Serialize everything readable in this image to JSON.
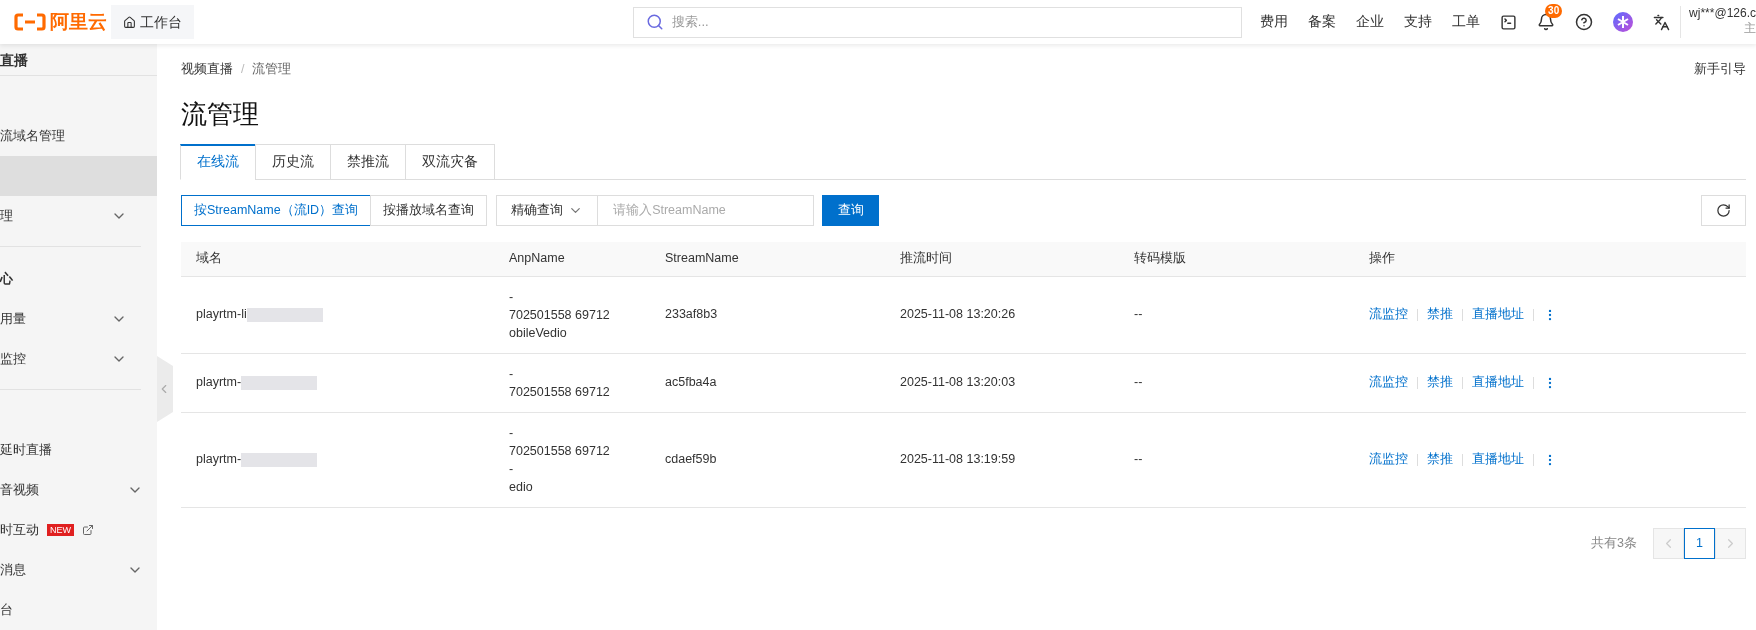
{
  "topbar": {
    "logo": "阿里云",
    "workbench": "工作台",
    "search": {
      "placeholder": "搜索..."
    },
    "links": [
      "费用",
      "备案",
      "企业",
      "支持",
      "工单"
    ],
    "notifications": "30",
    "user": "wj***@126.c",
    "role": "主"
  },
  "sidebar": {
    "title": "直播",
    "groups": [
      {
        "items": [
          {
            "label": "流域名管理",
            "selected": false,
            "expandable": false
          },
          {
            "selected": true,
            "expandable": false
          },
          {
            "label": "理",
            "selected": false,
            "expandable": true
          }
        ]
      },
      {
        "heading": "心",
        "items": [
          {
            "label": "用量",
            "selected": false,
            "expandable": true
          },
          {
            "label": "监控",
            "selected": false,
            "expandable": true
          }
        ]
      },
      {
        "items": [
          {
            "label": "延时直播",
            "selected": false,
            "expandable": false
          },
          {
            "label": "音视频",
            "selected": false,
            "expandable": true
          },
          {
            "label": "时互动",
            "badge": "NEW",
            "external": true,
            "selected": false,
            "expandable": false
          },
          {
            "label": "消息",
            "selected": false,
            "expandable": true
          },
          {
            "label": "台",
            "selected": false,
            "expandable": false
          }
        ]
      }
    ]
  },
  "breadcrumb": [
    "视频直播",
    "流管理"
  ],
  "breadcrumb_separator": "/",
  "guide": "新手引导",
  "title": "流管理",
  "tabs": [
    {
      "label": "在线流",
      "selected": true
    },
    {
      "label": "历史流",
      "selected": false
    },
    {
      "label": "禁推流",
      "selected": false
    },
    {
      "label": "双流灾备",
      "selected": false
    }
  ],
  "query": {
    "modes": [
      {
        "label": "按StreamName（流ID）查询",
        "selected": true
      },
      {
        "label": "按播放域名查询",
        "selected": false
      }
    ],
    "match": "精确查询",
    "input": {
      "placeholder": "请输入StreamName"
    },
    "submit": "查询"
  },
  "table": {
    "columns": [
      "域名",
      "AnpName",
      "StreamName",
      "推流时间",
      "转码模版",
      "操作"
    ],
    "rows": [
      {
        "domain": "playrtm-li",
        "app": [
          "-",
          "702501558 69712",
          "obileVedio"
        ],
        "stream": "233af8b3",
        "time": "2025-11-08 13:20:26",
        "template": "--",
        "actions": [
          "流监控",
          "禁推",
          "直播地址"
        ]
      },
      {
        "domain": "playrtm-",
        "app": [
          "-",
          "702501558 69712"
        ],
        "stream": "ac5fba4a",
        "time": "2025-11-08 13:20:03",
        "template": "--",
        "actions": [
          "流监控",
          "禁推",
          "直播地址"
        ]
      },
      {
        "domain": "playrtm-",
        "app": [
          "-",
          "702501558 69712",
          "-",
          "edio"
        ],
        "stream": "cdaef59b",
        "time": "2025-11-08 13:19:59",
        "template": "--",
        "actions": [
          "流监控",
          "禁推",
          "直播地址"
        ]
      }
    ]
  },
  "pagination": {
    "total": "共有3条",
    "pages": [
      {
        "label": "1",
        "selected": true
      }
    ]
  }
}
